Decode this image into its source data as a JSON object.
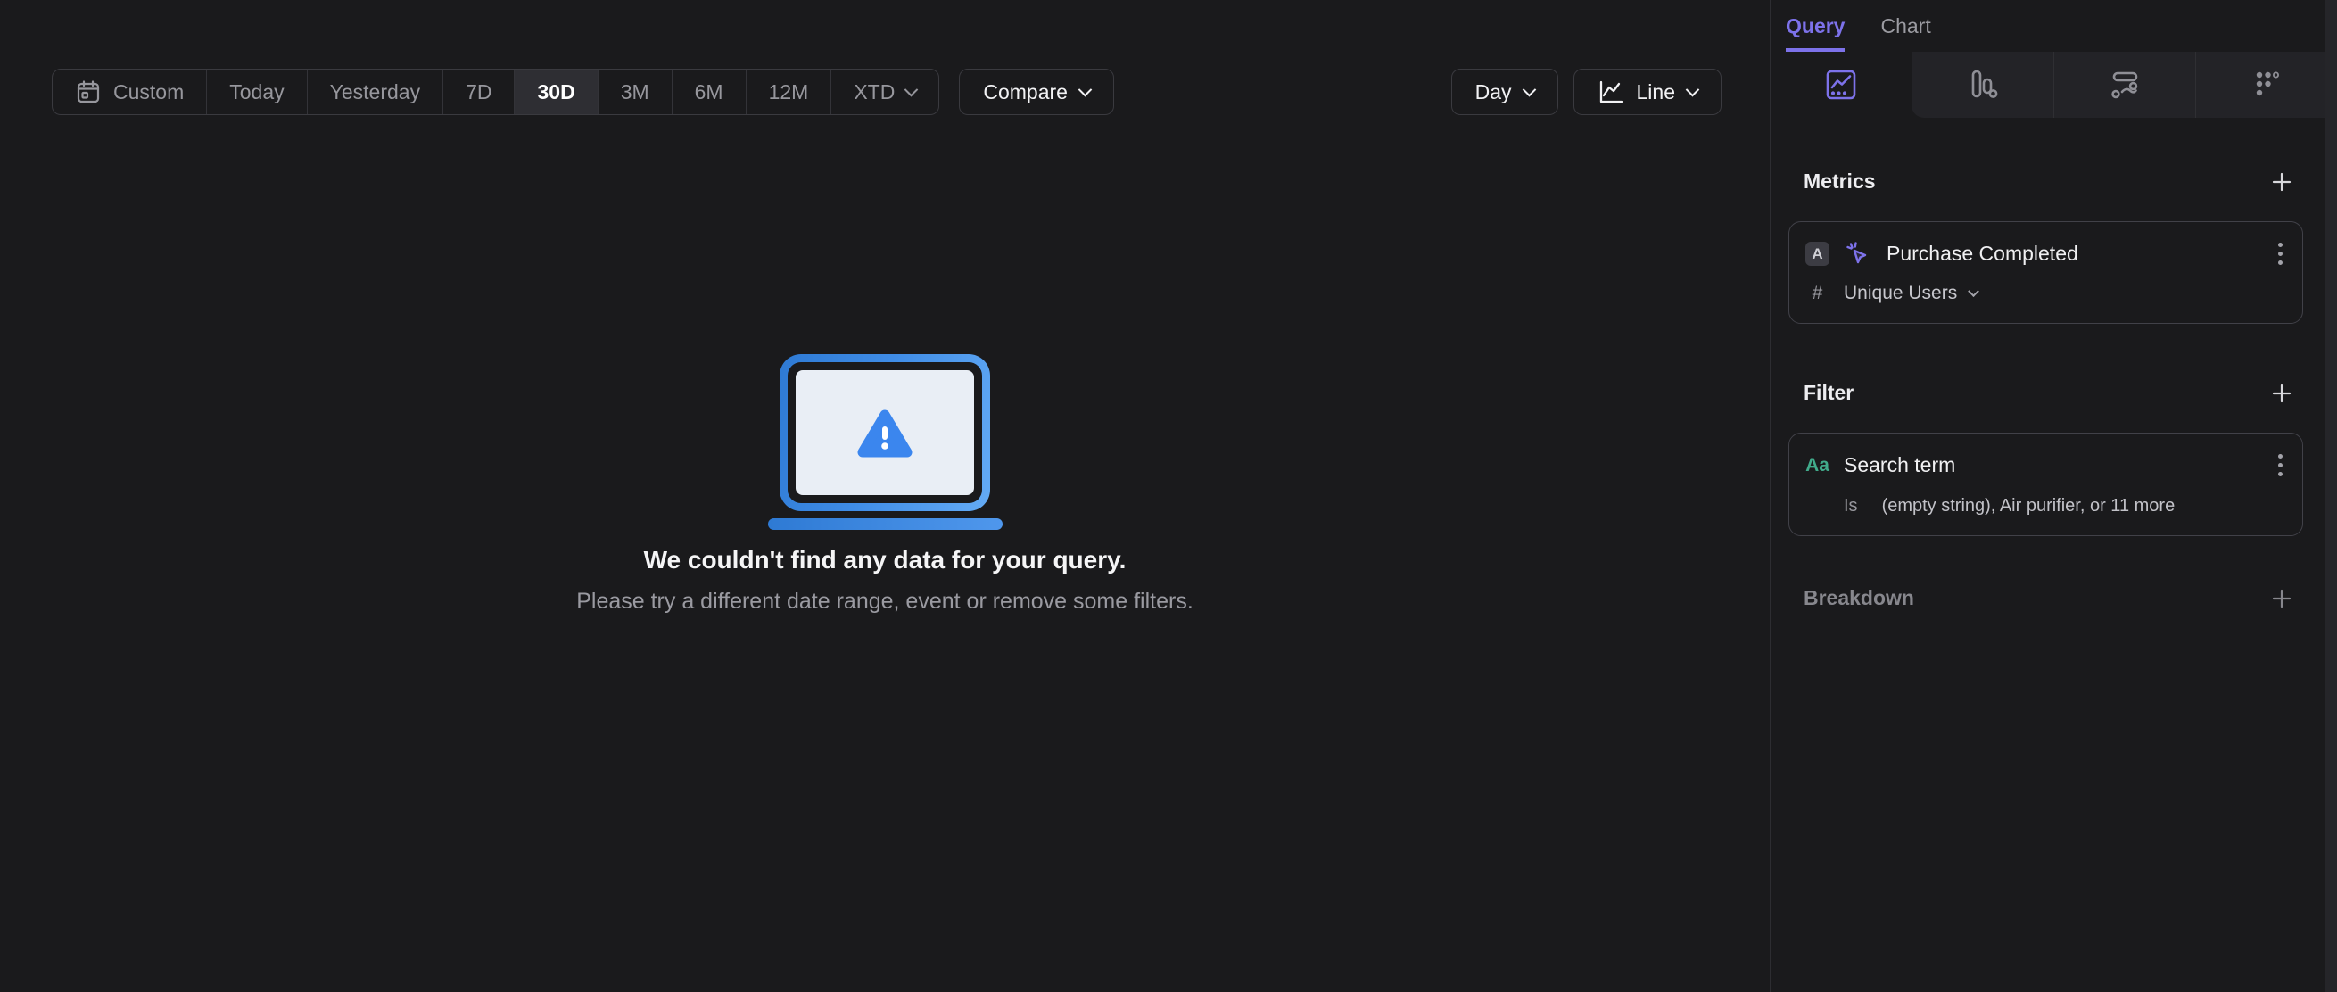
{
  "toolbar": {
    "date_ranges": [
      {
        "label": "Custom",
        "selected": false
      },
      {
        "label": "Today",
        "selected": false
      },
      {
        "label": "Yesterday",
        "selected": false
      },
      {
        "label": "7D",
        "selected": false
      },
      {
        "label": "30D",
        "selected": true
      },
      {
        "label": "3M",
        "selected": false
      },
      {
        "label": "6M",
        "selected": false
      },
      {
        "label": "12M",
        "selected": false
      },
      {
        "label": "XTD",
        "selected": false
      }
    ],
    "compare_label": "Compare",
    "granularity_label": "Day",
    "chart_type_label": "Line"
  },
  "empty_state": {
    "title": "We couldn't find any data for your query.",
    "subtitle": "Please try a different date range, event or remove some filters."
  },
  "panel": {
    "tabs": [
      {
        "label": "Query",
        "active": true
      },
      {
        "label": "Chart",
        "active": false
      }
    ],
    "report_tabs": [
      {
        "name": "insights",
        "selected": true
      },
      {
        "name": "funnels",
        "selected": false
      },
      {
        "name": "flows",
        "selected": false
      },
      {
        "name": "retention",
        "selected": false
      }
    ],
    "metrics": {
      "heading": "Metrics",
      "items": [
        {
          "letter": "A",
          "event": "Purchase Completed",
          "aggregation_symbol": "#",
          "aggregation": "Unique Users"
        }
      ]
    },
    "filter": {
      "heading": "Filter",
      "items": [
        {
          "type_label": "Aa",
          "property": "Search term",
          "operator": "Is",
          "value": "(empty string), Air purifier, or 11 more"
        }
      ]
    },
    "breakdown": {
      "heading": "Breakdown"
    }
  },
  "icons": [
    "calendar-icon",
    "chevron-down-icon",
    "line-chart-icon",
    "plus-icon",
    "insights-icon",
    "funnels-icon",
    "flows-icon",
    "retention-icon",
    "event-cursor-icon",
    "kebab-menu-icon",
    "monitor-warning-icon"
  ],
  "colors": {
    "accent_purple": "#7d72ea",
    "empty_state_blue": "#3f8ce6",
    "string_property_green": "#41ab8b",
    "selected_segment_bg": "#2e2e33",
    "background": "#1a1a1c"
  }
}
